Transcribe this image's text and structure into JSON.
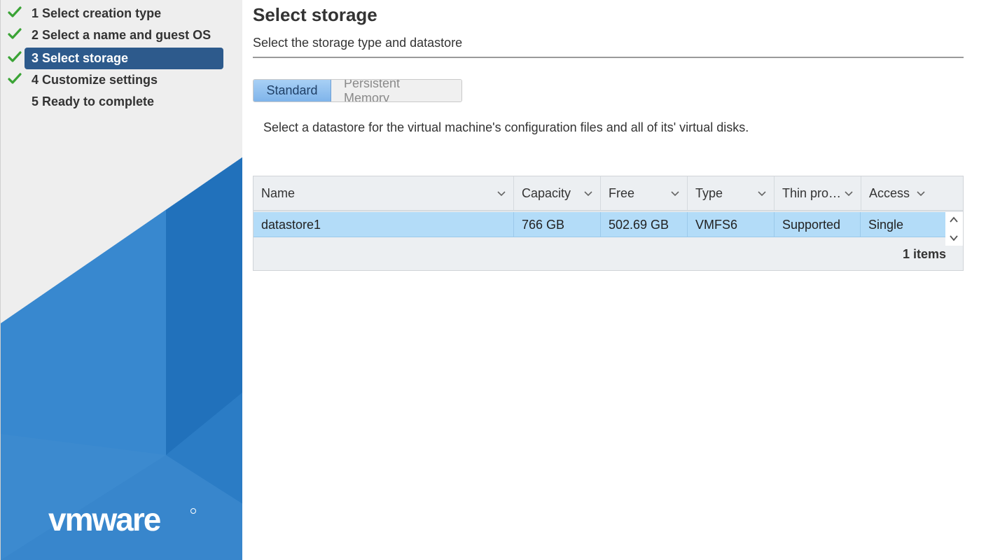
{
  "wizard": {
    "steps": [
      {
        "label": "1 Select creation type",
        "completed": true,
        "active": false
      },
      {
        "label": "2 Select a name and guest OS",
        "completed": true,
        "active": false
      },
      {
        "label": "3 Select storage",
        "completed": true,
        "active": true
      },
      {
        "label": "4 Customize settings",
        "completed": true,
        "active": false
      },
      {
        "label": "5 Ready to complete",
        "completed": false,
        "active": false
      }
    ],
    "logo_text": "vmware"
  },
  "colors": {
    "active_step_bg": "#2d5a8c",
    "check_green": "#3aa335",
    "selected_row": "#b3dcf8",
    "brand_blue": "#2a7bc6"
  },
  "page": {
    "title": "Select storage",
    "subtitle": "Select the storage type and datastore",
    "tabs": [
      {
        "label": "Standard",
        "selected": true
      },
      {
        "label": "Persistent Memory",
        "selected": false
      }
    ],
    "instructions": "Select a datastore for the virtual machine's configuration files and all of its' virtual disks."
  },
  "grid": {
    "columns": [
      "Name",
      "Capacity",
      "Free",
      "Type",
      "Thin pro…",
      "Access"
    ],
    "rows": [
      [
        "datastore1",
        "766 GB",
        "502.69 GB",
        "VMFS6",
        "Supported",
        "Single"
      ]
    ],
    "footer": "1 items"
  }
}
